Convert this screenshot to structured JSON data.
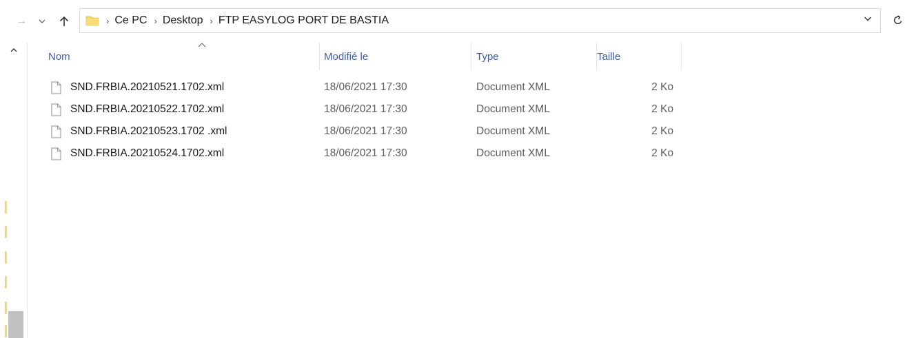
{
  "address_bar": {
    "crumbs": [
      "Ce PC",
      "Desktop",
      "FTP EASYLOG PORT DE BASTIA"
    ]
  },
  "icons": {
    "back": "arrow-left-icon",
    "forward_dropdown": "chevron-down-icon",
    "up": "arrow-up-icon",
    "folder": "folder-icon",
    "refresh": "refresh-icon",
    "file": "file-icon"
  },
  "colors": {
    "header_text": "#3d5aa8",
    "folder_yellow": "#f6d76b",
    "row_text": "#1a1a1a",
    "meta_text": "#5c5c5c"
  },
  "columns": {
    "name": "Nom",
    "modified": "Modifié le",
    "type": "Type",
    "size": "Taille"
  },
  "files": [
    {
      "name": "SND.FRBIA.20210521.1702.xml",
      "modified": "18/06/2021 17:30",
      "type": "Document XML",
      "size": "2 Ko"
    },
    {
      "name": "SND.FRBIA.20210522.1702.xml",
      "modified": "18/06/2021 17:30",
      "type": "Document XML",
      "size": "2 Ko"
    },
    {
      "name": "SND.FRBIA.20210523.1702 .xml",
      "modified": "18/06/2021 17:30",
      "type": "Document XML",
      "size": "2 Ko"
    },
    {
      "name": "SND.FRBIA.20210524.1702.xml",
      "modified": "18/06/2021 17:30",
      "type": "Document XML",
      "size": "2 Ko"
    }
  ]
}
